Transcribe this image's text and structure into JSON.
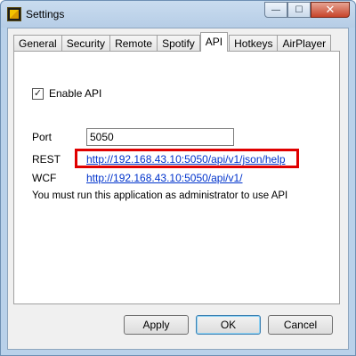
{
  "window": {
    "title": "Settings",
    "controls": {
      "minimize": "—",
      "maximize": "☐",
      "close": "✕"
    }
  },
  "tabs": [
    {
      "label": "General"
    },
    {
      "label": "Security"
    },
    {
      "label": "Remote"
    },
    {
      "label": "Spotify"
    },
    {
      "label": "API",
      "active": true
    },
    {
      "label": "Hotkeys"
    },
    {
      "label": "AirPlayer"
    }
  ],
  "api": {
    "enable_label": "Enable API",
    "enable_checked": "✓",
    "port_label": "Port",
    "port_value": "5050",
    "rest_label": "REST",
    "rest_url": "http://192.168.43.10:5050/api/v1/json/help",
    "wcf_label": "WCF",
    "wcf_url": "http://192.168.43.10:5050/api/v1/",
    "note": "You must run this application as administrator to use API"
  },
  "buttons": {
    "apply": "Apply",
    "ok": "OK",
    "cancel": "Cancel"
  },
  "colors": {
    "highlight": "#e00000",
    "link": "#0033cc"
  }
}
